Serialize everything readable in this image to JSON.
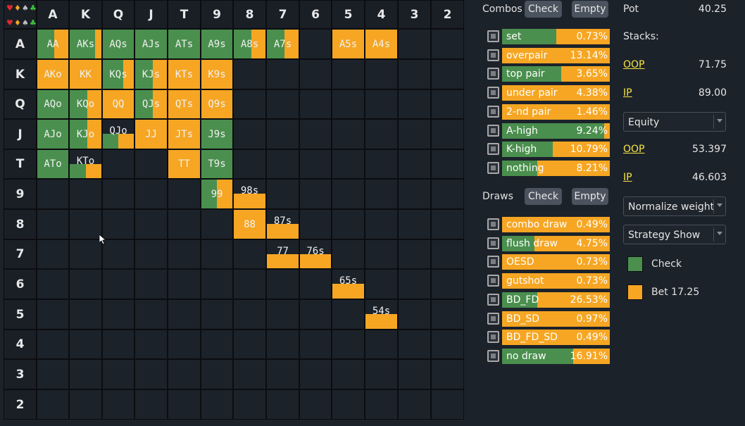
{
  "grid": {
    "corner_suits_top": [
      "♥",
      "♦",
      "♠",
      "♣"
    ],
    "corner_suits_bottom": [
      "♥",
      "♦",
      "♠",
      "♣"
    ],
    "col_headers": [
      "A",
      "K",
      "Q",
      "J",
      "T",
      "9",
      "8",
      "7",
      "6",
      "5",
      "4",
      "3",
      "2"
    ],
    "row_headers": [
      "A",
      "K",
      "Q",
      "J",
      "T",
      "9",
      "8",
      "7",
      "6",
      "5",
      "4",
      "3",
      "2"
    ],
    "cells": [
      {
        "label": "AA",
        "row": 0,
        "col": 0,
        "check": 0.55,
        "fill": 1.0
      },
      {
        "label": "AKs",
        "row": 0,
        "col": 1,
        "check": 0.8,
        "fill": 1.0
      },
      {
        "label": "AQs",
        "row": 0,
        "col": 2,
        "check": 1.0,
        "fill": 1.0
      },
      {
        "label": "AJs",
        "row": 0,
        "col": 3,
        "check": 1.0,
        "fill": 1.0
      },
      {
        "label": "ATs",
        "row": 0,
        "col": 4,
        "check": 1.0,
        "fill": 1.0
      },
      {
        "label": "A9s",
        "row": 0,
        "col": 5,
        "check": 1.0,
        "fill": 1.0
      },
      {
        "label": "A8s",
        "row": 0,
        "col": 6,
        "check": 0.55,
        "fill": 1.0
      },
      {
        "label": "A7s",
        "row": 0,
        "col": 7,
        "check": 0.55,
        "fill": 1.0
      },
      {
        "label": "A5s",
        "row": 0,
        "col": 9,
        "check": 0.0,
        "fill": 1.0
      },
      {
        "label": "A4s",
        "row": 0,
        "col": 10,
        "check": 0.0,
        "fill": 1.0
      },
      {
        "label": "AKo",
        "row": 1,
        "col": 0,
        "check": 0.0,
        "fill": 1.0
      },
      {
        "label": "KK",
        "row": 1,
        "col": 1,
        "check": 0.0,
        "fill": 1.0
      },
      {
        "label": "KQs",
        "row": 1,
        "col": 2,
        "check": 0.65,
        "fill": 1.0
      },
      {
        "label": "KJs",
        "row": 1,
        "col": 3,
        "check": 0.55,
        "fill": 1.0
      },
      {
        "label": "KTs",
        "row": 1,
        "col": 4,
        "check": 0.0,
        "fill": 1.0
      },
      {
        "label": "K9s",
        "row": 1,
        "col": 5,
        "check": 0.0,
        "fill": 1.0
      },
      {
        "label": "AQo",
        "row": 2,
        "col": 0,
        "check": 1.0,
        "fill": 1.0
      },
      {
        "label": "KQo",
        "row": 2,
        "col": 1,
        "check": 0.55,
        "fill": 1.0
      },
      {
        "label": "QQ",
        "row": 2,
        "col": 2,
        "check": 0.0,
        "fill": 1.0
      },
      {
        "label": "QJs",
        "row": 2,
        "col": 3,
        "check": 0.55,
        "fill": 1.0
      },
      {
        "label": "QTs",
        "row": 2,
        "col": 4,
        "check": 0.0,
        "fill": 1.0
      },
      {
        "label": "Q9s",
        "row": 2,
        "col": 5,
        "check": 0.0,
        "fill": 1.0
      },
      {
        "label": "AJo",
        "row": 3,
        "col": 0,
        "check": 1.0,
        "fill": 1.0
      },
      {
        "label": "KJo",
        "row": 3,
        "col": 1,
        "check": 0.55,
        "fill": 1.0
      },
      {
        "label": "QJo",
        "row": 3,
        "col": 2,
        "check": 0.5,
        "fill": 0.5
      },
      {
        "label": "JJ",
        "row": 3,
        "col": 3,
        "check": 0.0,
        "fill": 1.0
      },
      {
        "label": "JTs",
        "row": 3,
        "col": 4,
        "check": 0.0,
        "fill": 1.0
      },
      {
        "label": "J9s",
        "row": 3,
        "col": 5,
        "check": 1.0,
        "fill": 1.0
      },
      {
        "label": "ATo",
        "row": 4,
        "col": 0,
        "check": 1.0,
        "fill": 1.0
      },
      {
        "label": "KTo",
        "row": 4,
        "col": 1,
        "check": 0.5,
        "fill": 0.5
      },
      {
        "label": "TT",
        "row": 4,
        "col": 4,
        "check": 0.0,
        "fill": 1.0
      },
      {
        "label": "T9s",
        "row": 4,
        "col": 5,
        "check": 1.0,
        "fill": 1.0
      },
      {
        "label": "99",
        "row": 5,
        "col": 5,
        "check": 0.5,
        "fill": 1.0
      },
      {
        "label": "98s",
        "row": 5,
        "col": 6,
        "check": 0.0,
        "fill": 0.5
      },
      {
        "label": "88",
        "row": 6,
        "col": 6,
        "check": 0.0,
        "fill": 1.0
      },
      {
        "label": "87s",
        "row": 6,
        "col": 7,
        "check": 0.0,
        "fill": 0.5
      },
      {
        "label": "77",
        "row": 7,
        "col": 7,
        "check": 0.0,
        "fill": 0.5
      },
      {
        "label": "76s",
        "row": 7,
        "col": 8,
        "check": 0.0,
        "fill": 0.5
      },
      {
        "label": "65s",
        "row": 8,
        "col": 9,
        "check": 0.0,
        "fill": 0.5
      },
      {
        "label": "54s",
        "row": 9,
        "col": 10,
        "check": 0.0,
        "fill": 0.5
      }
    ]
  },
  "combos": {
    "label": "Combos",
    "check_button": "Check",
    "empty_button": "Empty",
    "rows": [
      {
        "name": "set",
        "pct": "0.73%",
        "check": 0.5
      },
      {
        "name": "overpair",
        "pct": "13.14%",
        "check": 0.0
      },
      {
        "name": "top pair",
        "pct": "3.65%",
        "check": 0.55
      },
      {
        "name": "under pair",
        "pct": "4.38%",
        "check": 0.0
      },
      {
        "name": "2-nd pair",
        "pct": "1.46%",
        "check": 0.0
      },
      {
        "name": "A-high",
        "pct": "9.24%",
        "check": 0.95
      },
      {
        "name": "K-high",
        "pct": "10.79%",
        "check": 0.47
      },
      {
        "name": "nothing",
        "pct": "8.21%",
        "check": 0.33
      }
    ]
  },
  "draws": {
    "label": "Draws",
    "check_button": "Check",
    "empty_button": "Empty",
    "rows": [
      {
        "name": "combo draw",
        "pct": "0.49%",
        "check": 0.0
      },
      {
        "name": "flush draw",
        "pct": "4.75%",
        "check": 0.3
      },
      {
        "name": "OESD",
        "pct": "0.73%",
        "check": 0.0
      },
      {
        "name": "gutshot",
        "pct": "0.73%",
        "check": 0.0
      },
      {
        "name": "BD_FD",
        "pct": "26.53%",
        "check": 0.33
      },
      {
        "name": "BD_SD",
        "pct": "0.97%",
        "check": 0.0
      },
      {
        "name": "BD_FD_SD",
        "pct": "0.49%",
        "check": 0.0
      },
      {
        "name": "no draw",
        "pct": "16.91%",
        "check": 0.66
      }
    ]
  },
  "right": {
    "pot_label": "Pot",
    "pot_value": "40.25",
    "stacks_label": "Stacks:",
    "oop_label": "OOP",
    "oop_stack": "71.75",
    "ip_label": "IP",
    "ip_stack": "89.00",
    "metric_select": "Equity",
    "oop_equity": "53.397",
    "ip_equity": "46.603",
    "normalize_select": "Normalize weight",
    "strategy_select": "Strategy Show",
    "legend": [
      {
        "label": "Check",
        "color": "#4a8f4e"
      },
      {
        "label": "Bet 17.25",
        "color": "#f6a623"
      }
    ]
  },
  "colors": {
    "check": "#4a8f4e",
    "bet": "#f6a623",
    "background": "#1c222a"
  }
}
